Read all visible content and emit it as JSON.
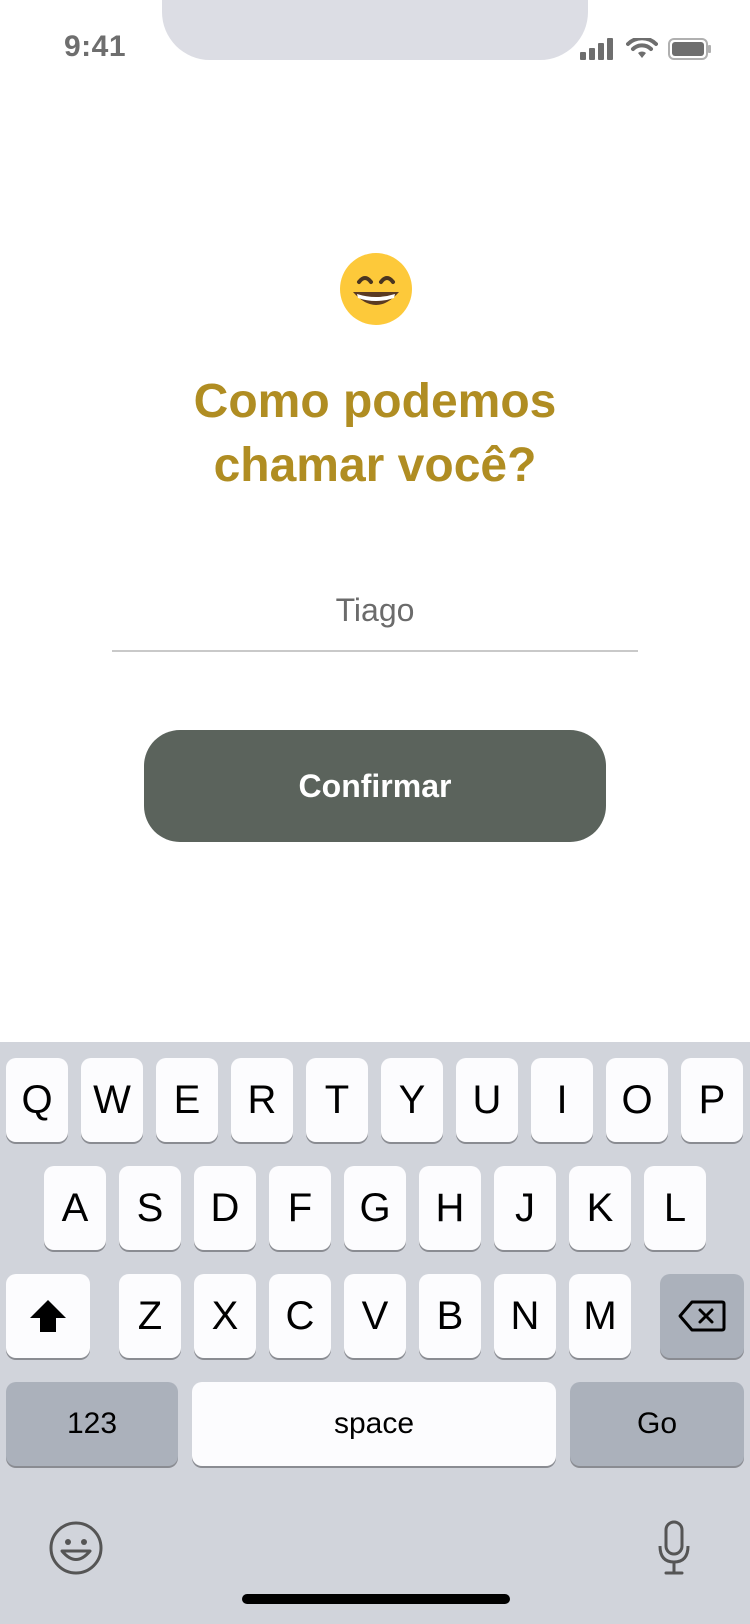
{
  "status_bar": {
    "time": "9:41"
  },
  "prompt": {
    "line1": "Como podemos",
    "line2": "chamar você?"
  },
  "name_field": {
    "value": "Tiago"
  },
  "confirm_button": {
    "label": "Confirmar"
  },
  "keyboard": {
    "row1": [
      "Q",
      "W",
      "E",
      "R",
      "T",
      "Y",
      "U",
      "I",
      "O",
      "P"
    ],
    "row2": [
      "A",
      "S",
      "D",
      "F",
      "G",
      "H",
      "J",
      "K",
      "L"
    ],
    "row3": [
      "Z",
      "X",
      "C",
      "V",
      "B",
      "N",
      "M"
    ],
    "numbers_label": "123",
    "space_label": "space",
    "go_label": "Go"
  },
  "colors": {
    "accent": "#b08d22",
    "button": "#5b635c",
    "keyboard_bg": "#d1d4db"
  },
  "icons": [
    "cellular-icon",
    "wifi-icon",
    "battery-icon",
    "grinning-emoji-icon",
    "shift-icon",
    "backspace-icon",
    "emoji-icon",
    "microphone-icon"
  ]
}
